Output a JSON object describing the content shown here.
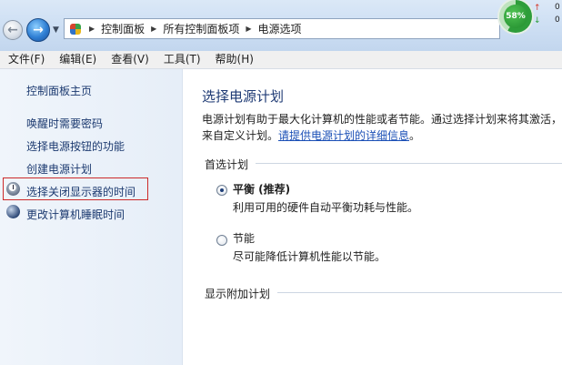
{
  "breadcrumb": [
    "控制面板",
    "所有控制面板项",
    "电源选项"
  ],
  "status_widget": {
    "percent": "58%",
    "upload_value": "0",
    "download_value": "0"
  },
  "menu": [
    "文件(F)",
    "编辑(E)",
    "查看(V)",
    "工具(T)",
    "帮助(H)"
  ],
  "left_pane": {
    "home_link": "控制面板主页",
    "links": [
      "唤醒时需要密码",
      "选择电源按钮的功能",
      "创建电源计划",
      "选择关闭显示器的时间",
      "更改计算机睡眠时间"
    ]
  },
  "main": {
    "title": "选择电源计划",
    "desc_line1": "电源计划有助于最大化计算机的性能或者节能。通过选择计划来将其激活，",
    "desc_line2_prefix": "来自定义计划。",
    "desc_link": "请提供电源计划的详细信息",
    "desc_line2_suffix": "。",
    "preferred_section": "首选计划",
    "plans": [
      {
        "name": "平衡 (推荐)",
        "description": "利用可用的硬件自动平衡功耗与性能。",
        "selected": true
      },
      {
        "name": "节能",
        "description": "尽可能降低计算机性能以节能。",
        "selected": false
      }
    ],
    "extra_section": "显示附加计划"
  },
  "colors": {
    "link": "#1c3a70",
    "title": "#1e3a74",
    "highlight_border": "#cc2a2a",
    "gauge": "#2e9d3a"
  }
}
